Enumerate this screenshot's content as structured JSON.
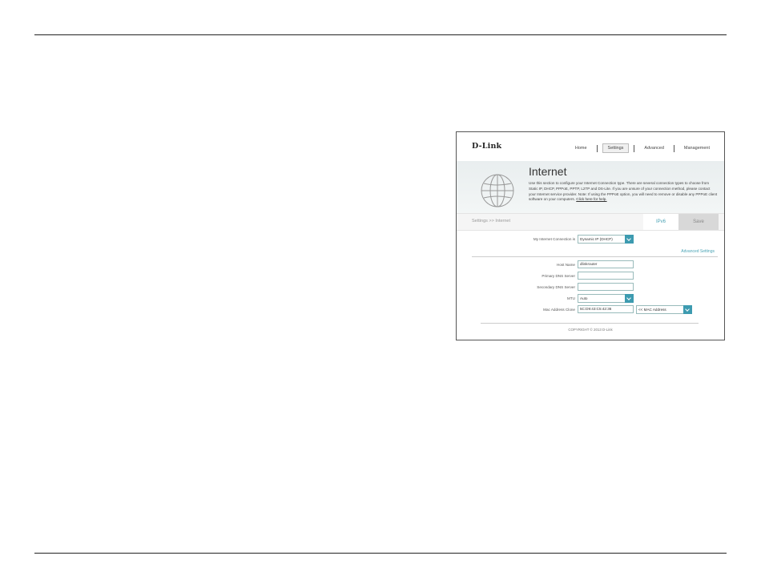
{
  "app": {
    "logo": "D-Link",
    "nav": [
      {
        "label": "Home",
        "active": false
      },
      {
        "label": "Settings",
        "active": true
      },
      {
        "label": "Advanced",
        "active": false
      },
      {
        "label": "Management",
        "active": false
      }
    ]
  },
  "banner": {
    "title": "Internet",
    "description": "Use this section to configure your Internet Connection type. There are several connection types to choose from Static IP, DHCP, PPPoE, PPTP, L2TP and DS-Lite. If you are unsure of your connection method, please contact your Internet service provider. Note: If using the PPPoE option, you will need to remove or disable any PPPoE client software on your computers.",
    "help_link": "Click here for help."
  },
  "breadcrumb": "Settings >> Internet",
  "buttons": {
    "ipv6": "IPv6",
    "save": "Save"
  },
  "form": {
    "connection_label": "My Internet Connection is",
    "connection_value": "Dynamic IP (DHCP)",
    "advanced_link": "Advanced Settings",
    "host_name_label": "Host Name",
    "host_name_value": "dlinkrouter",
    "primary_dns_label": "Primary DNS Server",
    "primary_dns_value": "",
    "secondary_dns_label": "Secondary DNS Server",
    "secondary_dns_value": "",
    "mtu_label": "MTU",
    "mtu_value": "Auto",
    "mac_clone_label": "Mac Address Clone",
    "mac_clone_value": "5C:D9:43:C5:42:36",
    "mac_clone_select": "<< MAC Address"
  },
  "footer": {
    "copyright": "COPYRIGHT © 2013 D-Link"
  },
  "colors": {
    "accent": "#3d9bb0",
    "link": "#4aa3b5",
    "save_bg": "#d8d8d8"
  }
}
